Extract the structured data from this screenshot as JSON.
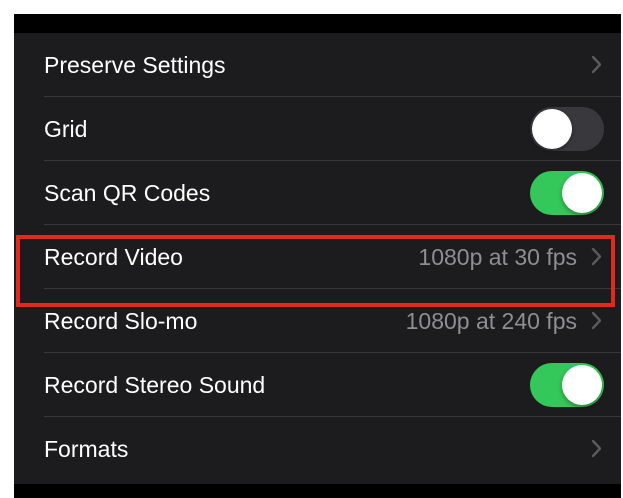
{
  "colors": {
    "background": "#1c1c1e",
    "toggle_on": "#34c759",
    "toggle_off": "#39393d",
    "highlight": "#e12a1f",
    "secondary_text": "#8e8e93"
  },
  "settings": {
    "preserve_settings": {
      "label": "Preserve Settings",
      "icon": "chevron-right-icon"
    },
    "grid": {
      "label": "Grid",
      "toggle": "off"
    },
    "scan_qr": {
      "label": "Scan QR Codes",
      "toggle": "on"
    },
    "record_video": {
      "label": "Record Video",
      "value": "1080p at 30 fps",
      "icon": "chevron-right-icon"
    },
    "record_slomo": {
      "label": "Record Slo-mo",
      "value": "1080p at 240 fps",
      "icon": "chevron-right-icon"
    },
    "stereo_sound": {
      "label": "Record Stereo Sound",
      "toggle": "on"
    },
    "formats": {
      "label": "Formats",
      "icon": "chevron-right-icon"
    }
  }
}
